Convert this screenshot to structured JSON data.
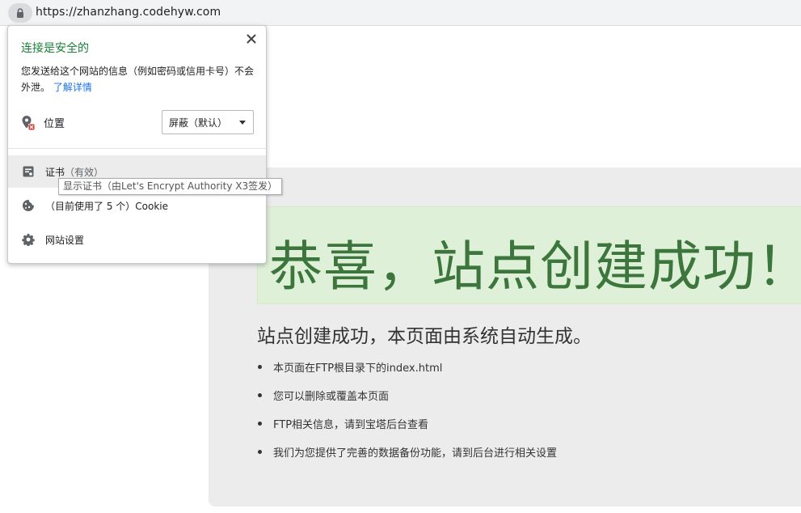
{
  "address_bar": {
    "url": "https://zhanzhang.codehyw.com"
  },
  "site_info_popup": {
    "title": "连接是安全的",
    "description": "您发送给这个网站的信息（例如密码或信用卡号）不会外泄。",
    "learn_more": "了解详情",
    "permission": {
      "label": "位置",
      "selected": "屏蔽（默认）"
    },
    "menu": {
      "certificate_label": "证书",
      "certificate_status": "（有效）",
      "cookie_label": "（目前使用了 5 个）Cookie",
      "site_settings_label": "网站设置"
    },
    "tooltip": "显示证书（由Let's Encrypt Authority X3签发）"
  },
  "page": {
    "hero_title": "恭喜，站点创建成功！",
    "subtitle": "站点创建成功，本页面由系统自动生成。",
    "bullets": [
      "本页面在FTP根目录下的index.html",
      "您可以删除或覆盖本页面",
      "FTP相关信息，请到宝塔后台查看",
      "我们为您提供了完善的数据备份功能，请到后台进行相关设置"
    ]
  },
  "colors": {
    "secure_green": "#188038",
    "link_blue": "#1a73e8",
    "hero_bg": "#dff0d8",
    "hero_text": "#3c763d"
  },
  "icons": {
    "address_bar": "lock-icon",
    "close": "close-icon",
    "permission": "location-blocked-icon",
    "certificate": "certificate-icon",
    "cookie": "cookie-icon",
    "settings": "gear-icon"
  }
}
